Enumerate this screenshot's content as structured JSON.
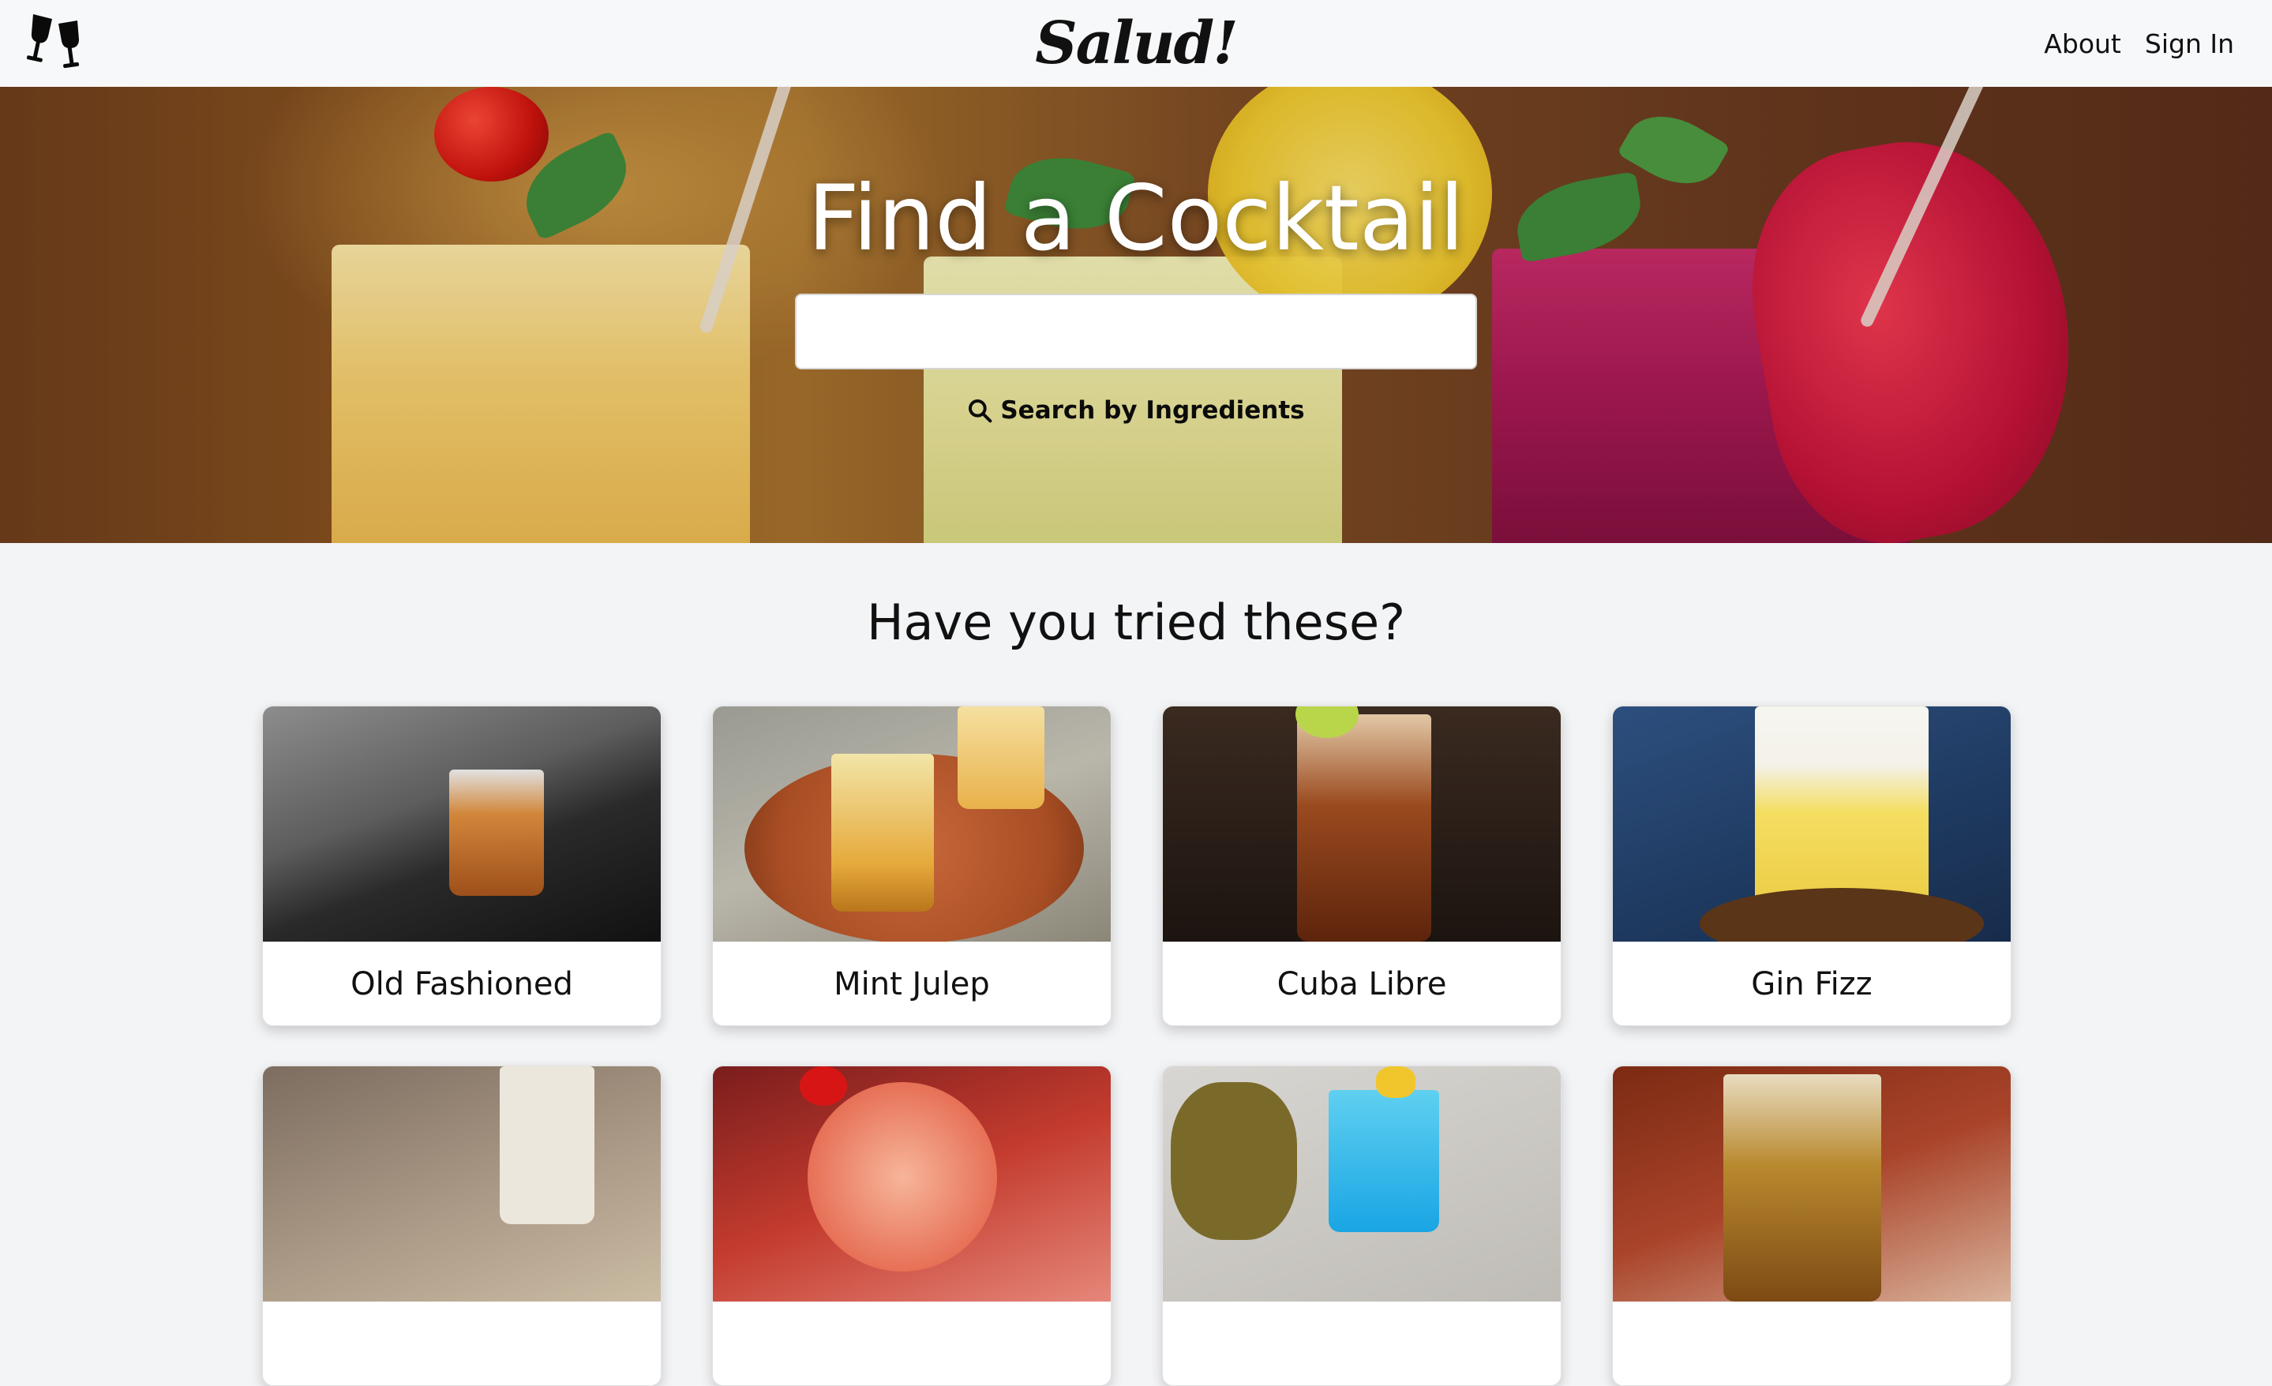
{
  "header": {
    "brand": "Salud!",
    "nav": [
      {
        "label": "About"
      },
      {
        "label": "Sign In"
      }
    ]
  },
  "hero": {
    "title": "Find a Cocktail",
    "search_value": "",
    "search_placeholder": "",
    "ingredients_link": "Search by Ingredients"
  },
  "suggestions": {
    "title": "Have you tried these?",
    "cards": [
      {
        "name": "Old Fashioned"
      },
      {
        "name": "Mint Julep"
      },
      {
        "name": "Cuba Libre"
      },
      {
        "name": "Gin Fizz"
      },
      {
        "name": ""
      },
      {
        "name": ""
      },
      {
        "name": ""
      },
      {
        "name": ""
      }
    ]
  },
  "colors": {
    "page_bg": "#f3f4f6",
    "header_bg": "#f7f8fa",
    "text": "#111111",
    "card_bg": "#ffffff"
  }
}
